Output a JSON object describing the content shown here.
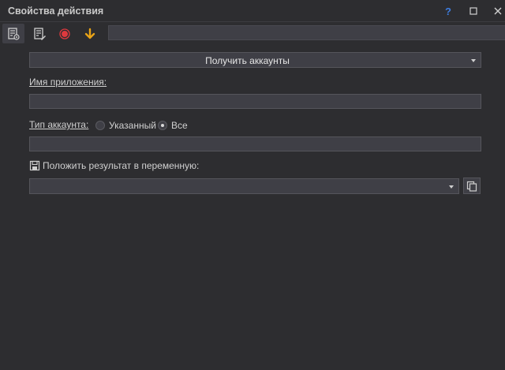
{
  "window": {
    "title": "Свойства действия",
    "help_label": "?",
    "help_color": "#3d7de0"
  },
  "toolbar": {
    "tools": [
      {
        "icon": "document-settings-icon",
        "active": true
      },
      {
        "icon": "document-edit-icon",
        "active": false
      },
      {
        "icon": "record-icon",
        "color": "#e0393e"
      },
      {
        "icon": "arrow-down-icon",
        "color": "#e8a317"
      }
    ],
    "name_value": ""
  },
  "action_select": {
    "value": "Получить аккаунты"
  },
  "app_name": {
    "label": "Имя приложения:",
    "value": ""
  },
  "account_type": {
    "label": "Тип аккаунта:",
    "options": [
      {
        "label": "Указанный",
        "checked": false
      },
      {
        "label": "Все",
        "checked": true
      }
    ],
    "value": ""
  },
  "result": {
    "label": "Положить результат в переменную:",
    "value": ""
  }
}
